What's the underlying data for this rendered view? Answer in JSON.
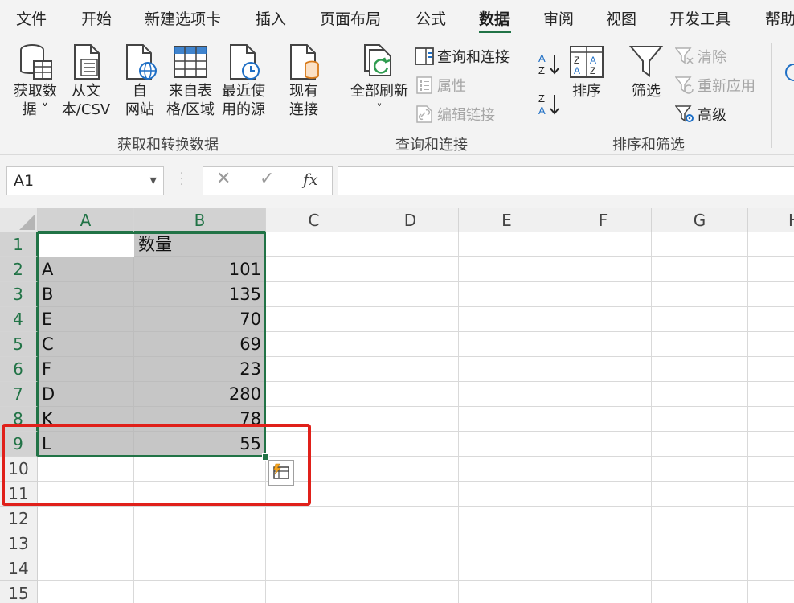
{
  "menu_tabs": [
    "文件",
    "开始",
    "新建选项卡",
    "插入",
    "页面布局",
    "公式",
    "数据",
    "审阅",
    "视图",
    "开发工具",
    "帮助"
  ],
  "active_tab": "数据",
  "ribbon": {
    "get_transform": {
      "buttons": [
        {
          "line1": "获取数",
          "line2": "据 ˅"
        },
        {
          "line1": "从文",
          "line2": "本/CSV"
        },
        {
          "line1": "自",
          "line2": "网站"
        },
        {
          "line1": "来自表",
          "line2": "格/区域"
        },
        {
          "line1": "最近使",
          "line2": "用的源"
        },
        {
          "line1": "现有",
          "line2": "连接"
        }
      ],
      "label": "获取和转换数据"
    },
    "queries": {
      "refresh_line1": "全部刷新",
      "refresh_line2": "˅",
      "query_connections": "查询和连接",
      "properties": "属性",
      "edit_links": "编辑链接",
      "label": "查询和连接"
    },
    "sort_filter": {
      "sort": "排序",
      "filter": "筛选",
      "clear": "清除",
      "reapply": "重新应用",
      "advanced": "高级",
      "label": "排序和筛选"
    }
  },
  "formula_bar": {
    "name_box": "A1",
    "cancel": "✕",
    "enter": "✓",
    "fx": "fx",
    "formula": ""
  },
  "columns": [
    "A",
    "B",
    "C",
    "D",
    "E",
    "F",
    "G",
    "H"
  ],
  "rows": [
    "1",
    "2",
    "3",
    "4",
    "5",
    "6",
    "7",
    "8",
    "9",
    "10",
    "11",
    "12",
    "13",
    "14",
    "15"
  ],
  "table": {
    "header": [
      "",
      "数量"
    ],
    "data": [
      [
        "A",
        "101"
      ],
      [
        "B",
        "135"
      ],
      [
        "E",
        "70"
      ],
      [
        "C",
        "69"
      ],
      [
        "F",
        "23"
      ],
      [
        "D",
        "280"
      ],
      [
        "K",
        "78"
      ],
      [
        "L",
        "55"
      ]
    ]
  },
  "colors": {
    "excel_green": "#217346",
    "selection_gray": "#c6c6c6",
    "annotation_red": "#e0201a"
  }
}
